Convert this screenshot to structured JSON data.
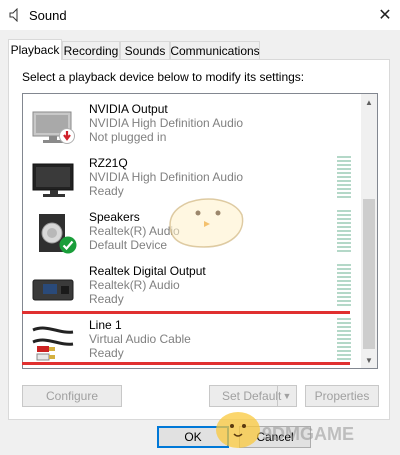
{
  "window": {
    "title": "Sound",
    "close_glyph": "✕"
  },
  "tabs": [
    {
      "label": "Playback",
      "active": true
    },
    {
      "label": "Recording",
      "active": false
    },
    {
      "label": "Sounds",
      "active": false
    },
    {
      "label": "Communications",
      "active": false
    }
  ],
  "instruction": "Select a playback device below to modify its settings:",
  "devices": [
    {
      "name": "NVIDIA Output",
      "description": "NVIDIA High Definition Audio",
      "status": "Not plugged in",
      "icon": "monitor-icon",
      "badge": "unplugged-arrow-icon"
    },
    {
      "name": "RZ21Q",
      "description": "NVIDIA High Definition Audio",
      "status": "Ready",
      "icon": "monitor-icon",
      "badge": ""
    },
    {
      "name": "Speakers",
      "description": "Realtek(R) Audio",
      "status": "Default Device",
      "icon": "speaker-icon",
      "badge": "default-check-icon"
    },
    {
      "name": "Realtek Digital Output",
      "description": "Realtek(R) Audio",
      "status": "Ready",
      "icon": "digital-output-icon",
      "badge": ""
    },
    {
      "name": "Line 1",
      "description": "Virtual Audio Cable",
      "status": "Ready",
      "icon": "rca-cable-icon",
      "badge": ""
    }
  ],
  "buttons": {
    "configure": "Configure",
    "set_default": "Set Default",
    "properties": "Properties",
    "ok": "OK",
    "cancel": "Cancel"
  },
  "watermark": "9DMGAME",
  "colors": {
    "highlight_line": "#e03030",
    "meter": "#b4d8c8",
    "default_check": "#1a9e3a",
    "accent": "#0078d7"
  }
}
